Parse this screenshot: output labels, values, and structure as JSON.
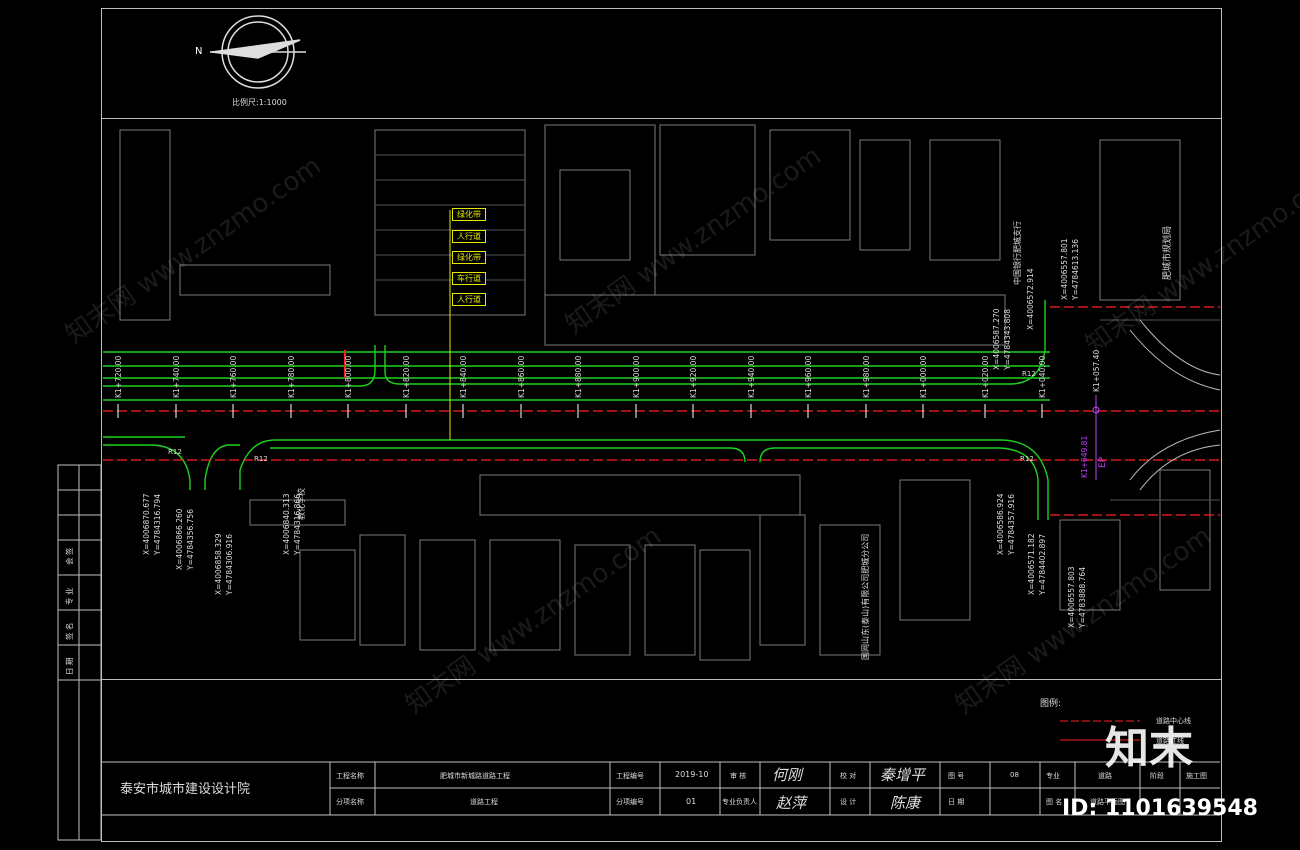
{
  "scale_label": "比例尺:1:1000",
  "north_label": "N",
  "road_legend": [
    "绿化带",
    "人行道",
    "绿化带",
    "车行道",
    "人行道"
  ],
  "stations": [
    "K1+720.00",
    "K1+740.00",
    "K1+760.00",
    "K1+780.00",
    "K1+800.00",
    "K1+820.00",
    "K1+840.00",
    "K1+860.00",
    "K1+880.00",
    "K1+900.00",
    "K1+920.00",
    "K1+940.00",
    "K1+960.00",
    "K1+980.00",
    "K1+000.00",
    "K1+020.00",
    "K1+040.00"
  ],
  "coords_top": [
    "X=4006587.270",
    "Y=4784343.808",
    "X=4006572.914",
    "X=4006557.801",
    "Y=4784613.136"
  ],
  "coords_bottom": [
    "X=4006870.677",
    "Y=4784316.794",
    "X=4006866.260",
    "Y=4784356.756",
    "X=4006858.329",
    "Y=4784306.916",
    "X=4006840.313",
    "Y=4784316.866",
    "X=4006586.924",
    "Y=4784357.916",
    "X=4006571.182",
    "Y=4784402.897",
    "X=4006557.803",
    "Y=4783888.764"
  ],
  "special_labels": {
    "end_station": "K1+057.40",
    "ep": "EP",
    "ep_station": "K1+049.81",
    "curve_labels": [
      "R12",
      "R12",
      "R12",
      "R12"
    ]
  },
  "side_labels": {
    "right_building": "肥城市规划局",
    "bank": "中国银行肥城支行",
    "company": "国网山东(泰山)有限公司肥城分公司",
    "bldg_left": "教化学校"
  },
  "legend": {
    "title": "图例:",
    "items": [
      "道路中心线",
      "道路红线"
    ]
  },
  "title_block": {
    "institute": "泰安市城市建设设计院",
    "project_name_label": "工程名称",
    "project_name": "肥城市新城路道路工程",
    "sub_name_label": "分项名称",
    "sub_name": "道路工程",
    "proj_no_label": "工程编号",
    "proj_no": "2019-10",
    "sub_no_label": "分项编号",
    "sub_no": "01",
    "review_label": "审 核",
    "lead_label": "专业负责人",
    "check_label": "校 对",
    "design_label": "设 计",
    "drawing_no_label": "图 号",
    "drawing_no": "08",
    "sheet_label": "图 名",
    "sheet": "道路平面图",
    "sig1": "何刚",
    "sig2": "赵萍",
    "sig3": "秦增平",
    "sig4": "陈康",
    "date_label": "日 期",
    "scale_label": "比 例",
    "major_label": "专业",
    "major": "道路",
    "stage_label": "阶段",
    "stage": "施工图"
  },
  "side_strip": [
    "会 签",
    "专 业",
    "签 名",
    "日 期"
  ],
  "watermark": "知末网 www.znzmo.com",
  "brand": "知末",
  "id_text": "ID: 1101639548",
  "colors": {
    "road": "#1fd11f",
    "center": "#ff2020",
    "frame": "#bfbfbf",
    "yellow": "#e6e600",
    "magenta": "#c040ff"
  }
}
